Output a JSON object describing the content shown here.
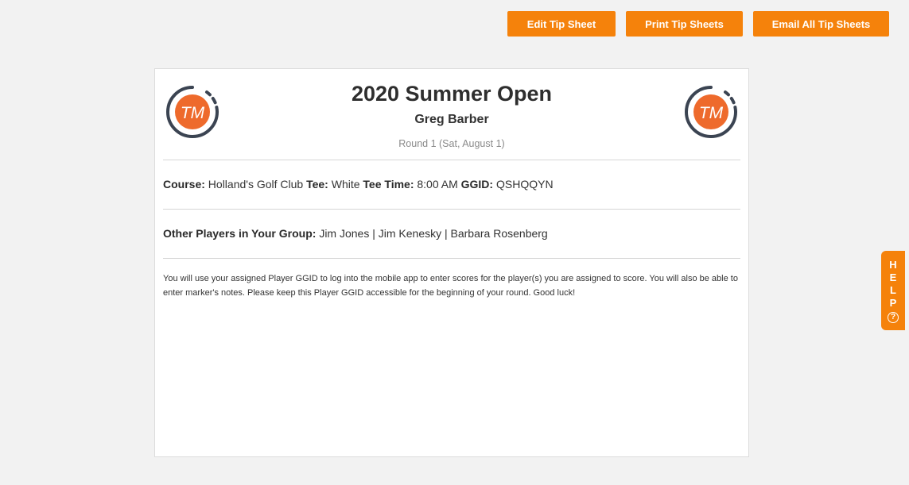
{
  "toolbar": {
    "edit_label": "Edit Tip Sheet",
    "print_label": "Print Tip Sheets",
    "email_label": "Email All Tip Sheets"
  },
  "logo": {
    "text": "TM",
    "ring_color": "#3b4452",
    "fill_color": "#ee6a2c"
  },
  "sheet": {
    "title": "2020 Summer Open",
    "player": "Greg Barber",
    "round": "Round 1 (Sat, August 1)",
    "course_label": "Course:",
    "course_value": "Holland's Golf Club",
    "tee_label": "Tee:",
    "tee_value": "White",
    "tee_time_label": "Tee Time:",
    "tee_time_value": "8:00 AM",
    "ggid_label": "GGID:",
    "ggid_value": "QSHQQYN",
    "group_label": "Other Players in Your Group:",
    "group_value": "Jim Jones | Jim Kenesky | Barbara Rosenberg",
    "note": "You will use your assigned Player GGID to log into the mobile app to enter scores for the player(s) you are assigned to score. You will also be able to enter marker's notes. Please keep this Player GGID accessible for the beginning of your round. Good luck!"
  },
  "help": {
    "label": "HELP",
    "icon": "question-circle-icon"
  },
  "colors": {
    "accent": "#f5820b",
    "background": "#f2f2f2"
  }
}
